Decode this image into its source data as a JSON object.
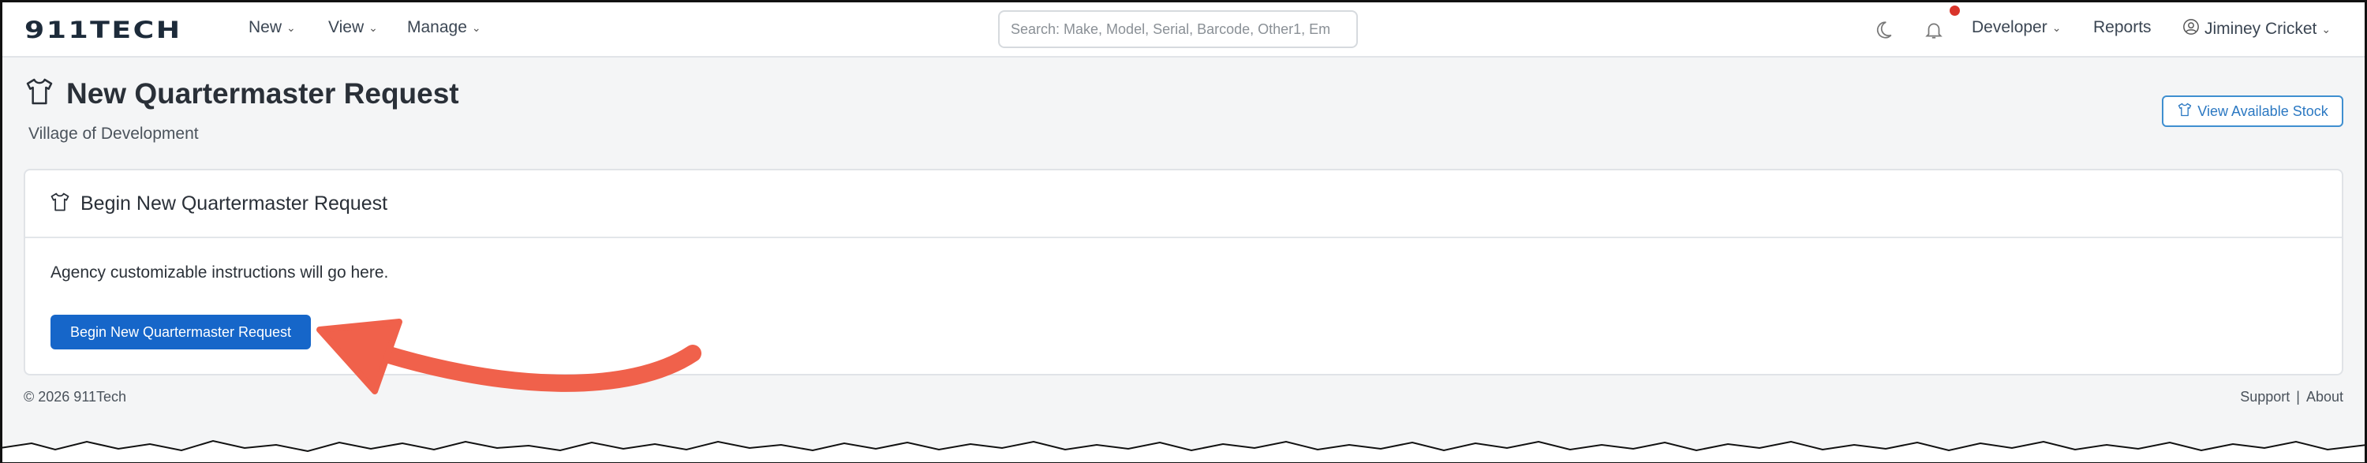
{
  "brand": {
    "logo_text": "911TECH"
  },
  "nav": {
    "new_label": "New",
    "view_label": "View",
    "manage_label": "Manage",
    "search_placeholder": "Search: Make, Model, Serial, Barcode, Other1, Em",
    "developer_label": "Developer",
    "reports_label": "Reports",
    "user_label": "Jiminey Cricket",
    "notification_dot_color": "#d9342b"
  },
  "page": {
    "title": "New Quartermaster Request",
    "subtitle": "Village of Development",
    "view_stock_label": "View Available Stock"
  },
  "card": {
    "title": "Begin New Quartermaster Request",
    "instructions": "Agency customizable instructions will go here.",
    "begin_button_label": "Begin New Quartermaster Request"
  },
  "footer": {
    "copyright": "© 2026 911Tech",
    "support_label": "Support",
    "separator": "|",
    "about_label": "About"
  },
  "colors": {
    "primary": "#1666c9",
    "annotation_arrow": "#f0614b",
    "outline_button": "#2b78c2"
  }
}
